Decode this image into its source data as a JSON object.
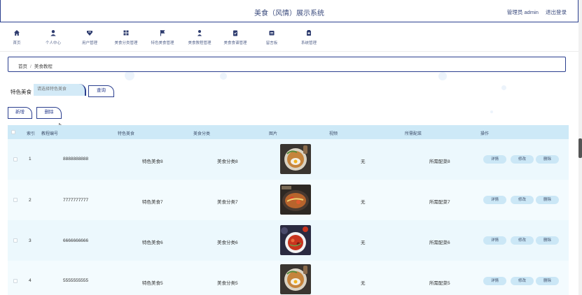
{
  "header": {
    "title": "美食（风情）展示系统",
    "user": "管理员 admin",
    "logout": "退出登录"
  },
  "nav": [
    {
      "label": "首页",
      "icon": "home-icon"
    },
    {
      "label": "个人中心",
      "icon": "user-icon"
    },
    {
      "label": "用户管理",
      "icon": "user-manage-icon"
    },
    {
      "label": "美食分类管理",
      "icon": "grid-icon"
    },
    {
      "label": "特色美食管理",
      "icon": "flag-icon"
    },
    {
      "label": "美食教程管理",
      "icon": "person-icon"
    },
    {
      "label": "美食食谱管理",
      "icon": "clipboard-icon"
    },
    {
      "label": "留言板",
      "icon": "message-icon"
    },
    {
      "label": "系统管理",
      "icon": "settings-icon"
    }
  ],
  "breadcrumb": {
    "home": "首页",
    "sep": "/",
    "current": "美食教程"
  },
  "search": {
    "label": "特色美食",
    "placeholder": "请选择特色美食",
    "button": "查询"
  },
  "actions": {
    "add": "新增",
    "delete": "删除"
  },
  "table": {
    "headers": [
      "索引",
      "教程编号",
      "特色美食",
      "美食分类",
      "图片",
      "视频",
      "所需配菜",
      "操作"
    ],
    "rows": [
      {
        "index": "1",
        "code": "8888888888",
        "food": "特色美食8",
        "category": "美食分类8",
        "video": "无",
        "side": "所需配菜8"
      },
      {
        "index": "2",
        "code": "7777777777",
        "food": "特色美食7",
        "category": "美食分类7",
        "video": "无",
        "side": "所需配菜7"
      },
      {
        "index": "3",
        "code": "6666666666",
        "food": "特色美食6",
        "category": "美食分类6",
        "video": "无",
        "side": "所需配菜6"
      },
      {
        "index": "4",
        "code": "5555555555",
        "food": "特色美食5",
        "category": "美食分类5",
        "video": "无",
        "side": "所需配菜5"
      }
    ],
    "row_actions": {
      "detail": "详情",
      "edit": "修改",
      "delete": "删除"
    }
  },
  "colors": {
    "border": "#2b3f8f",
    "header_bg": "#cde9f7",
    "table_bg": "#ecf8fd",
    "pill": "#cbe7f6",
    "input": "#d3eaf7"
  }
}
